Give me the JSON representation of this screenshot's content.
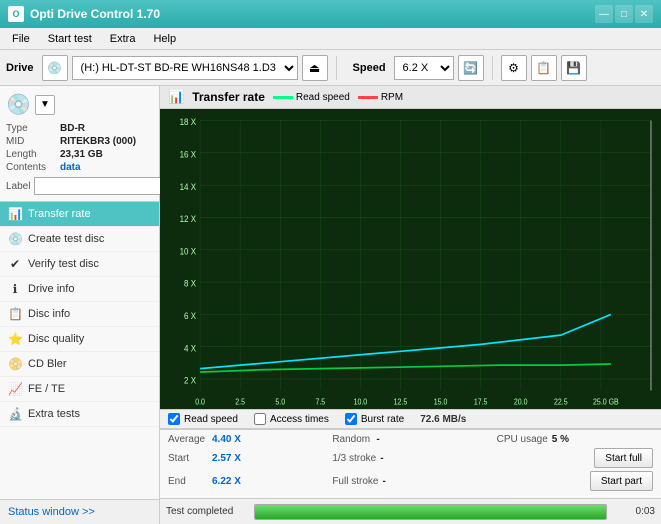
{
  "titlebar": {
    "title": "Opti Drive Control 1.70",
    "icon": "O",
    "minimize": "—",
    "maximize": "□",
    "close": "✕"
  },
  "menubar": {
    "items": [
      "File",
      "Start test",
      "Extra",
      "Help"
    ]
  },
  "toolbar": {
    "drive_label": "Drive",
    "drive_value": "(H:) HL-DT-ST BD-RE  WH16NS48 1.D3",
    "speed_label": "Speed",
    "speed_value": "6.2 X"
  },
  "disc": {
    "type_label": "Type",
    "type_value": "BD-R",
    "mid_label": "MID",
    "mid_value": "RITEKBR3 (000)",
    "length_label": "Length",
    "length_value": "23,31 GB",
    "contents_label": "Contents",
    "contents_value": "data",
    "label_label": "Label",
    "label_placeholder": ""
  },
  "nav": {
    "items": [
      {
        "id": "transfer-rate",
        "label": "Transfer rate",
        "icon": "📊",
        "active": true
      },
      {
        "id": "create-test-disc",
        "label": "Create test disc",
        "icon": "💿"
      },
      {
        "id": "verify-test-disc",
        "label": "Verify test disc",
        "icon": "✔"
      },
      {
        "id": "drive-info",
        "label": "Drive info",
        "icon": "ℹ"
      },
      {
        "id": "disc-info",
        "label": "Disc info",
        "icon": "📋"
      },
      {
        "id": "disc-quality",
        "label": "Disc quality",
        "icon": "⭐"
      },
      {
        "id": "cd-bler",
        "label": "CD Bler",
        "icon": "📀"
      },
      {
        "id": "fe-te",
        "label": "FE / TE",
        "icon": "📈"
      },
      {
        "id": "extra-tests",
        "label": "Extra tests",
        "icon": "🔬"
      }
    ],
    "status_window": "Status window >> "
  },
  "chart": {
    "title": "Transfer rate",
    "legend_read": "Read speed",
    "legend_rpm": "RPM",
    "y_labels": [
      "18 X",
      "16 X",
      "14 X",
      "12 X",
      "10 X",
      "8 X",
      "6 X",
      "4 X",
      "2 X"
    ],
    "x_labels": [
      "0.0",
      "2.5",
      "5.0",
      "7.5",
      "10.0",
      "12.5",
      "15.0",
      "17.5",
      "20.0",
      "22.5",
      "25.0 GB"
    ],
    "legend_bar": {
      "read_speed_label": "Read speed",
      "access_times_label": "Access times",
      "burst_rate_label": "Burst rate",
      "burst_rate_value": "72.6 MB/s"
    }
  },
  "stats": {
    "average_label": "Average",
    "average_value": "4.40 X",
    "random_label": "Random",
    "random_value": "-",
    "cpu_usage_label": "CPU usage",
    "cpu_usage_value": "5 %",
    "start_label": "Start",
    "start_value": "2.57 X",
    "stroke_1_3_label": "1/3 stroke",
    "stroke_1_3_value": "-",
    "start_full_label": "Start full",
    "end_label": "End",
    "end_value": "6.22 X",
    "full_stroke_label": "Full stroke",
    "full_stroke_value": "-",
    "start_part_label": "Start part"
  },
  "progress": {
    "status_text": "Test completed",
    "progress_percent": 100,
    "time_value": "0:03"
  }
}
